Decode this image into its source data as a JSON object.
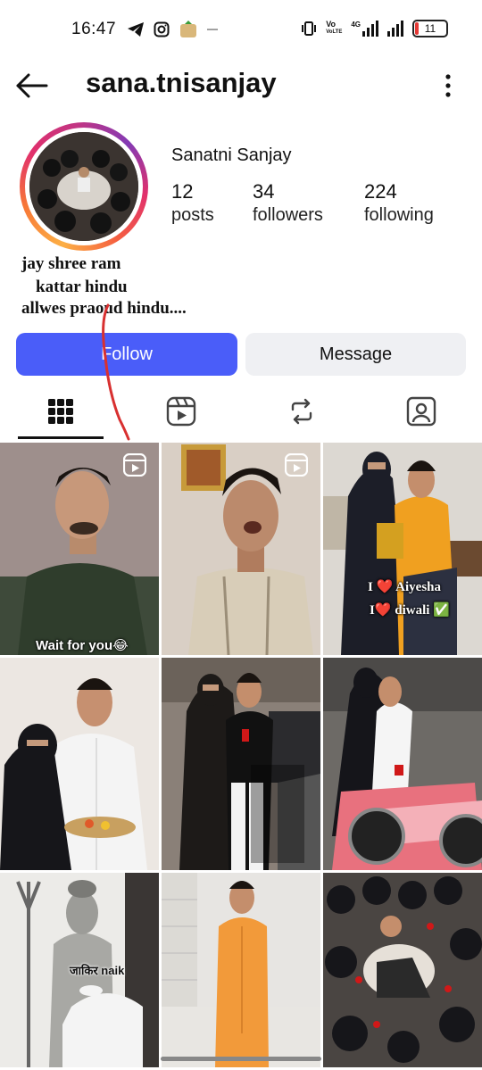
{
  "status_bar": {
    "time": "16:47",
    "network_label": "VoLTE",
    "network_type": "4G",
    "battery": "11",
    "battery_level": 0.11
  },
  "header": {
    "username": "sana.tnisanjay",
    "back_icon": "arrow-left-icon",
    "more_icon": "more-vertical-icon"
  },
  "profile": {
    "display_name": "Sanatni Sanjay",
    "stats": [
      {
        "value": "12",
        "label": "posts"
      },
      {
        "value": "34",
        "label": "followers"
      },
      {
        "value": "224",
        "label": "following"
      }
    ],
    "bio_lines": [
      "jay shree ram",
      "kattar hindu",
      "allwes praoud hindu...."
    ]
  },
  "actions": {
    "follow_label": "Follow",
    "message_label": "Message",
    "follow_color": "#4a5df9"
  },
  "tabs": [
    {
      "icon": "grid-icon",
      "active": true
    },
    {
      "icon": "reels-icon",
      "active": false
    },
    {
      "icon": "reposts-icon",
      "active": false
    },
    {
      "icon": "tagged-icon",
      "active": false
    }
  ],
  "posts": [
    {
      "caption": "Wait for you😂",
      "is_reel": true
    },
    {
      "caption": "",
      "is_reel": true
    },
    {
      "caption_lines": [
        "I ❤️ Aiyesha",
        "I❤️ diwali ✅"
      ],
      "is_reel": false
    },
    {
      "caption": "",
      "is_reel": false
    },
    {
      "caption": "",
      "is_reel": false
    },
    {
      "caption": "",
      "is_reel": false
    },
    {
      "caption": "जाकिर naik",
      "is_reel": false
    },
    {
      "caption": "",
      "is_reel": false
    },
    {
      "caption": "",
      "is_reel": false
    }
  ]
}
